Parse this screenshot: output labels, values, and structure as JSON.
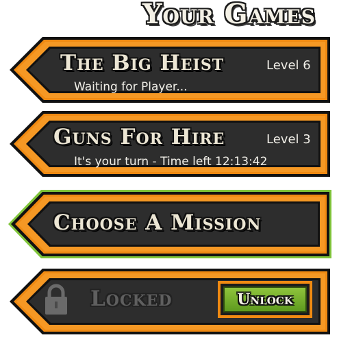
{
  "header": {
    "title": "Your Games"
  },
  "games": [
    {
      "title": "The Big Heist",
      "level": "Level 6",
      "status": "Waiting for Player..."
    },
    {
      "title": "Guns For Hire",
      "level": "Level 3",
      "status": "It's your turn - Time left 12:13:42"
    }
  ],
  "mission": {
    "label": "Choose A Mission"
  },
  "locked_slot": {
    "label": "Locked",
    "unlock_label": "Unlock",
    "icon": "padlock-icon"
  },
  "colors": {
    "frame_orange": "#f08a12",
    "panel_dark": "#2b2b2b",
    "highlight_green": "#7fc43a",
    "unlock_green": "#6fa829"
  }
}
